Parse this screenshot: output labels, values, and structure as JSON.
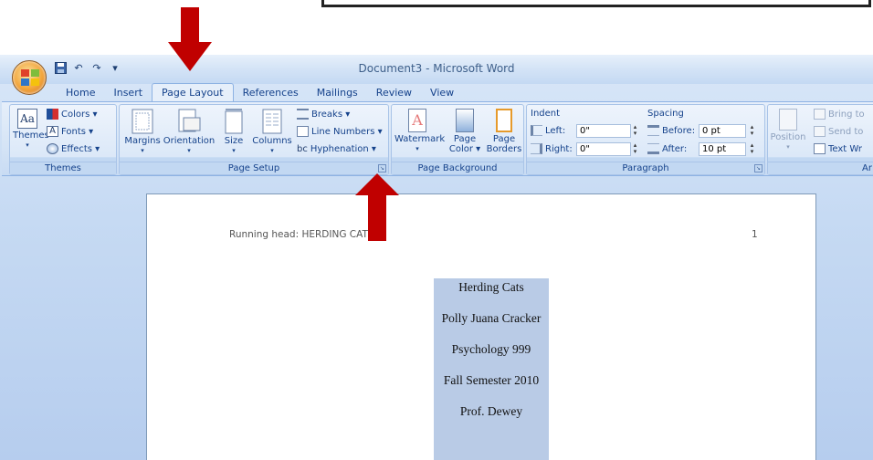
{
  "window": {
    "title": "Document3 - Microsoft Word"
  },
  "quick_access": {
    "save_icon": "save-icon",
    "undo_symbol": "↶",
    "redo_symbol": "↷",
    "customize_symbol": "▾"
  },
  "tabs": [
    "Home",
    "Insert",
    "Page Layout",
    "References",
    "Mailings",
    "Review",
    "View"
  ],
  "ribbon": {
    "themes": {
      "label": "Themes",
      "themes_button": "Themes",
      "colors": "Colors ▾",
      "fonts": "Fonts ▾",
      "effects": "Effects ▾",
      "themes_glyph": "Aa",
      "fonts_glyph": "A"
    },
    "page_setup": {
      "label": "Page Setup",
      "margins": "Margins",
      "orientation": "Orientation",
      "size": "Size",
      "columns": "Columns",
      "breaks": "Breaks ▾",
      "line_numbers": "Line Numbers ▾",
      "hyphenation": "Hyphenation ▾",
      "hyphenation_glyph": "bc"
    },
    "page_background": {
      "label": "Page Background",
      "watermark": "Watermark",
      "page_color_1": "Page",
      "page_color_2": "Color ▾",
      "page_borders_1": "Page",
      "page_borders_2": "Borders",
      "watermark_glyph": "A"
    },
    "paragraph": {
      "label": "Paragraph",
      "indent": "Indent",
      "left_label": "Left:",
      "left_value": "0\"",
      "right_label": "Right:",
      "right_value": "0\"",
      "spacing": "Spacing",
      "before_label": "Before:",
      "before_value": "0 pt",
      "after_label": "After:",
      "after_value": "10 pt"
    },
    "arrange": {
      "label": "Ar",
      "position": "Position",
      "bring_to": "Bring to",
      "send_to": "Send to",
      "text_wrap": "Text Wr"
    },
    "launcher_glyph": "↘"
  },
  "document": {
    "running_head": "Running head: HERDING CATS",
    "page_number": "1",
    "lines": [
      "Herding Cats",
      "Polly Juana Cracker",
      "Psychology 999",
      "Fall Semester 2010",
      "Prof. Dewey"
    ]
  },
  "colors": {
    "arrow": "#c00000",
    "selection": "#b9cbe6",
    "ribbon": "#dbe8f8"
  }
}
